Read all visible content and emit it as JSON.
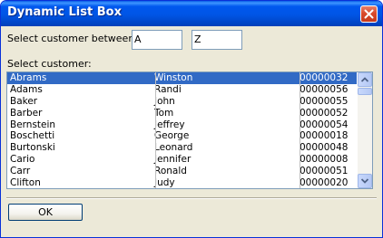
{
  "window": {
    "title": "Dynamic List Box"
  },
  "filter": {
    "label": "Select customer between:",
    "from_value": "A",
    "to_value": "Z"
  },
  "list": {
    "label": "Select customer:",
    "selected_index": 0,
    "rows": [
      {
        "last": "Abrams",
        "first": "Winston",
        "id": "00000032"
      },
      {
        "last": "Adams",
        "first": "Randi",
        "id": "00000056"
      },
      {
        "last": "Baker",
        "first": "John",
        "id": "00000055"
      },
      {
        "last": "Barber",
        "first": "Tom",
        "id": "00000052"
      },
      {
        "last": "Bernstein",
        "first": "Jeffrey",
        "id": "00000054"
      },
      {
        "last": "Boschetti",
        "first": "George",
        "id": "00000018"
      },
      {
        "last": "Burtonski",
        "first": "Leonard",
        "id": "00000048"
      },
      {
        "last": "Cario",
        "first": "Jennifer",
        "id": "00000008"
      },
      {
        "last": "Carr",
        "first": "Ronald",
        "id": "00000051"
      },
      {
        "last": "Clifton",
        "first": "Judy",
        "id": "00000020"
      }
    ]
  },
  "buttons": {
    "ok_label": "OK"
  }
}
